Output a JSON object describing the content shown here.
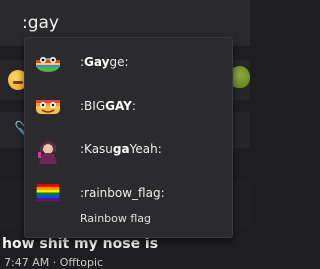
{
  "composer": {
    "value": ":gay"
  },
  "autocomplete": {
    "items": [
      {
        "pre": ":",
        "match": "Gay",
        "post": "ge:",
        "icon": "gayge-frog-emote-icon"
      },
      {
        "pre": ":BIG",
        "match": "GAY",
        "post": ":",
        "icon": "biggay-emote-icon"
      },
      {
        "pre": ":Kasu",
        "match": "ga",
        "post": "Yeah:",
        "icon": "kasugayeah-emote-icon"
      },
      {
        "pre": ":rainbow_flag:",
        "match": "",
        "post": "",
        "icon": "rainbow-flag-icon",
        "description": "Rainbow flag"
      }
    ]
  },
  "message": {
    "title": "how shit my nose is",
    "meta": "7:47 AM · Offtopic"
  },
  "colors": {
    "flag": [
      "#e40303",
      "#ff8c00",
      "#ffed00",
      "#008026",
      "#004dff",
      "#750787"
    ]
  }
}
